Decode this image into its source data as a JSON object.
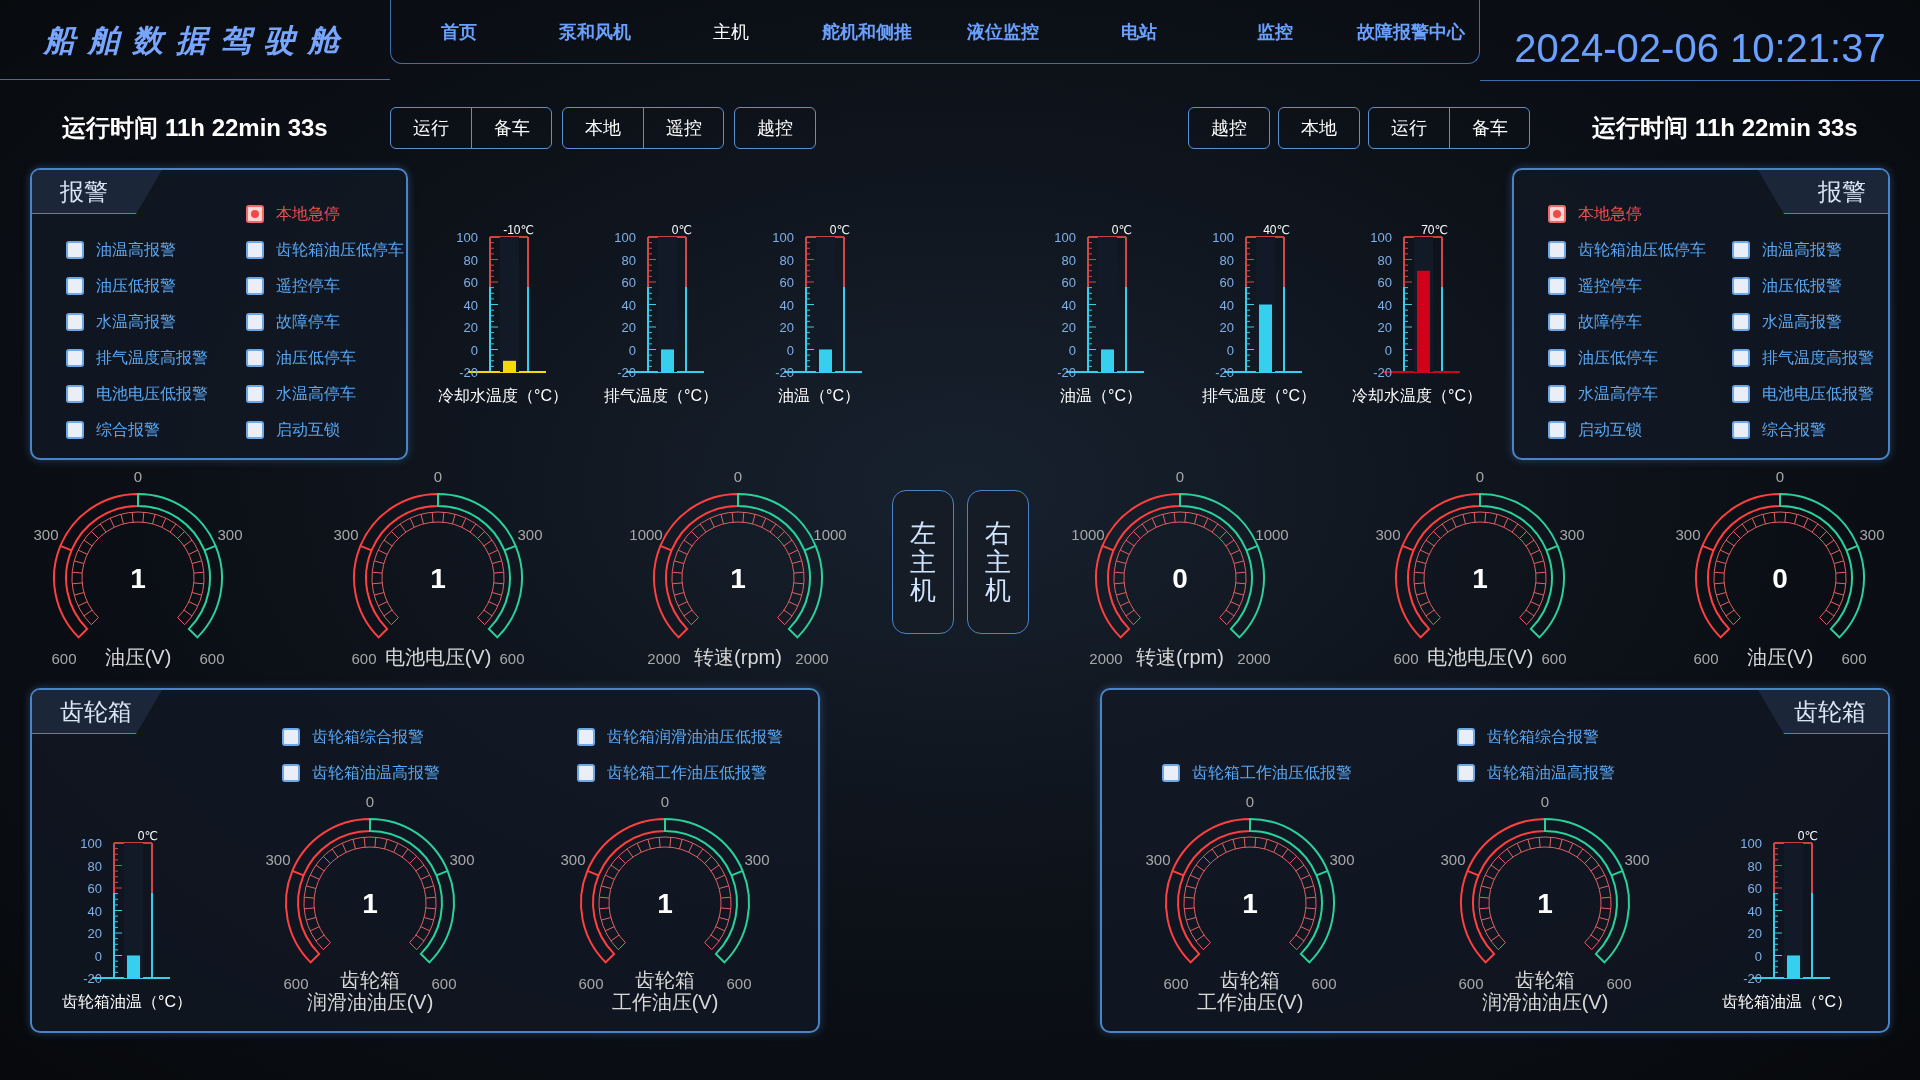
{
  "title": "船舶数据驾驶舱",
  "nav": [
    {
      "label": "首页",
      "selected": false
    },
    {
      "label": "泵和风机",
      "selected": false
    },
    {
      "label": "主机",
      "selected": true
    },
    {
      "label": "舵机和侧推",
      "selected": false
    },
    {
      "label": "液位监控",
      "selected": false
    },
    {
      "label": "电站",
      "selected": false
    },
    {
      "label": "监控",
      "selected": false
    },
    {
      "label": "故障报警中心",
      "selected": false
    }
  ],
  "datetime": "2024-02-06 10:21:37",
  "engines": [
    {
      "name": "左主机",
      "runtime": "运行时间 11h 22min 33s",
      "mode_groups": [
        [
          "运行",
          "备车"
        ],
        [
          "本地",
          "遥控"
        ],
        [
          "越控"
        ]
      ],
      "alarm_panel": {
        "title": "报警",
        "columns": [
          [
            {
              "label": "油温高报警",
              "checked": false
            },
            {
              "label": "油压低报警",
              "checked": false
            },
            {
              "label": "水温高报警",
              "checked": false
            },
            {
              "label": "排气温度高报警",
              "checked": false
            },
            {
              "label": "电池电压低报警",
              "checked": false
            },
            {
              "label": "综合报警",
              "checked": false
            }
          ],
          [
            {
              "label": "本地急停",
              "checked": true
            },
            {
              "label": "齿轮箱油压低停车",
              "checked": false
            },
            {
              "label": "遥控停车",
              "checked": false
            },
            {
              "label": "故障停车",
              "checked": false
            },
            {
              "label": "油压低停车",
              "checked": false
            },
            {
              "label": "水温高停车",
              "checked": false
            },
            {
              "label": "启动互锁",
              "checked": false
            }
          ]
        ]
      },
      "thermometers": [
        {
          "label": "冷却水温度（°C）",
          "reading": "-10℃",
          "level": 0.083,
          "color": "#f5d90a",
          "scale": [
            "100",
            "80",
            "60",
            "40",
            "20",
            "0",
            "-20"
          ]
        },
        {
          "label": "排气温度（°C）",
          "reading": "0℃",
          "level": 0.167,
          "color": "#36cfee",
          "scale": [
            "100",
            "80",
            "60",
            "40",
            "20",
            "0",
            "-20"
          ]
        },
        {
          "label": "油温（°C）",
          "reading": "0℃",
          "level": 0.167,
          "color": "#36cfee",
          "scale": [
            "100",
            "80",
            "60",
            "40",
            "20",
            "0",
            "-20"
          ]
        }
      ],
      "gauges": [
        {
          "label": "油压(V)",
          "value": "1",
          "ticks": [
            "0",
            "300",
            "300",
            "600",
            "600"
          ]
        },
        {
          "label": "电池电压(V)",
          "value": "1",
          "ticks": [
            "0",
            "300",
            "300",
            "600",
            "600"
          ]
        },
        {
          "label": "转速(rpm)",
          "value": "1",
          "ticks": [
            "0",
            "1000",
            "1000",
            "2000",
            "2000"
          ]
        }
      ],
      "gearbox": {
        "title": "齿轮箱",
        "parts": [
          {
            "kind": "thermometer",
            "label": "齿轮箱油温（°C）",
            "reading": "0℃",
            "level": 0.167,
            "color": "#36cfee",
            "scale": [
              "100",
              "80",
              "60",
              "40",
              "20",
              "0",
              "-20"
            ]
          },
          {
            "kind": "column",
            "alarms": [
              {
                "label": "齿轮箱综合报警",
                "checked": false
              },
              {
                "label": "齿轮箱油温高报警",
                "checked": false
              }
            ],
            "gauge": {
              "title": "齿轮箱",
              "label": "润滑油油压(V)",
              "value": "1",
              "ticks": [
                "0",
                "300",
                "300",
                "600",
                "600"
              ]
            }
          },
          {
            "kind": "column",
            "alarms": [
              {
                "label": "齿轮箱润滑油油压低报警",
                "checked": false
              },
              {
                "label": "齿轮箱工作油压低报警",
                "checked": false
              }
            ],
            "gauge": {
              "title": "齿轮箱",
              "label": "工作油压(V)",
              "value": "1",
              "ticks": [
                "0",
                "300",
                "300",
                "600",
                "600"
              ]
            }
          }
        ]
      }
    },
    {
      "name": "右主机",
      "runtime": "运行时间 11h 22min 33s",
      "mode_groups": [
        [
          "越控"
        ],
        [
          "本地"
        ],
        [
          "运行",
          "备车"
        ]
      ],
      "alarm_panel": {
        "title": "报警",
        "columns": [
          [
            {
              "label": "本地急停",
              "checked": true
            },
            {
              "label": "齿轮箱油压低停车",
              "checked": false
            },
            {
              "label": "遥控停车",
              "checked": false
            },
            {
              "label": "故障停车",
              "checked": false
            },
            {
              "label": "油压低停车",
              "checked": false
            },
            {
              "label": "水温高停车",
              "checked": false
            },
            {
              "label": "启动互锁",
              "checked": false
            }
          ],
          [
            {
              "label": "油温高报警",
              "checked": false
            },
            {
              "label": "油压低报警",
              "checked": false
            },
            {
              "label": "水温高报警",
              "checked": false
            },
            {
              "label": "排气温度高报警",
              "checked": false
            },
            {
              "label": "电池电压低报警",
              "checked": false
            },
            {
              "label": "综合报警",
              "checked": false
            }
          ]
        ]
      },
      "thermometers": [
        {
          "label": "油温（°C）",
          "reading": "0℃",
          "level": 0.167,
          "color": "#36cfee",
          "scale": [
            "100",
            "80",
            "60",
            "40",
            "20",
            "0",
            "-20"
          ]
        },
        {
          "label": "排气温度（°C）",
          "reading": "40℃",
          "level": 0.5,
          "color": "#36cfee",
          "scale": [
            "100",
            "80",
            "60",
            "40",
            "20",
            "0",
            "-20"
          ]
        },
        {
          "label": "冷却水温度（°C）",
          "reading": "70℃",
          "level": 0.75,
          "color": "#d0021b",
          "scale": [
            "100",
            "80",
            "60",
            "40",
            "20",
            "0",
            "-20"
          ]
        }
      ],
      "gauges": [
        {
          "label": "转速(rpm)",
          "value": "0",
          "ticks": [
            "0",
            "1000",
            "1000",
            "2000",
            "2000"
          ]
        },
        {
          "label": "电池电压(V)",
          "value": "1",
          "ticks": [
            "0",
            "300",
            "300",
            "600",
            "600"
          ]
        },
        {
          "label": "油压(V)",
          "value": "0",
          "ticks": [
            "0",
            "300",
            "300",
            "600",
            "600"
          ]
        }
      ],
      "gearbox": {
        "title": "齿轮箱",
        "parts": [
          {
            "kind": "column",
            "alarms": [
              {
                "label": "齿轮箱工作油压低报警",
                "checked": false
              }
            ],
            "gauge": {
              "title": "齿轮箱",
              "label": "工作油压(V)",
              "value": "1",
              "ticks": [
                "0",
                "300",
                "300",
                "600",
                "600"
              ]
            }
          },
          {
            "kind": "column",
            "alarms": [
              {
                "label": "齿轮箱综合报警",
                "checked": false
              },
              {
                "label": "齿轮箱油温高报警",
                "checked": false
              }
            ],
            "gauge": {
              "title": "齿轮箱",
              "label": "润滑油油压(V)",
              "value": "1",
              "ticks": [
                "0",
                "300",
                "300",
                "600",
                "600"
              ]
            }
          },
          {
            "kind": "thermometer",
            "label": "齿轮箱油温（°C）",
            "reading": "0℃",
            "level": 0.167,
            "color": "#36cfee",
            "scale": [
              "100",
              "80",
              "60",
              "40",
              "20",
              "0",
              "-20"
            ]
          }
        ]
      }
    }
  ]
}
